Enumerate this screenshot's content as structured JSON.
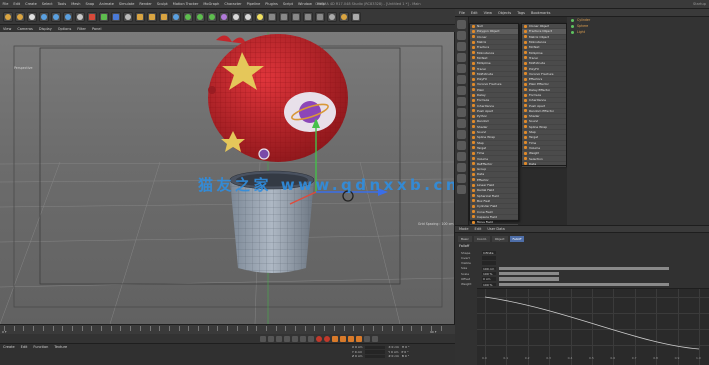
{
  "window": {
    "title": "CINEMA 4D R17.048 Studio (RC83328) - [Untitled 1 *] - Main",
    "right_text": "Startup"
  },
  "menubar": [
    "File",
    "Edit",
    "Create",
    "Select",
    "Tools",
    "Mesh",
    "Snap",
    "Animate",
    "Simulate",
    "Render",
    "Sculpt",
    "Motion Tracker",
    "MoGraph",
    "Character",
    "Pipeline",
    "Plugins",
    "Script",
    "Window",
    "Help"
  ],
  "viewport": {
    "menu": [
      "View",
      "Cameras",
      "Display",
      "Options",
      "Filter",
      "Panel"
    ],
    "label": "Perspective",
    "resolution": "Grid Spacing : 100 cm"
  },
  "watermark": "猫友之家 www.qdnxxb.cn",
  "popup_left": [
    "Null",
    "Polygon Object",
    "Cloner",
    "Matrix",
    "Fracture",
    "MoInstance",
    "MoText",
    "MoSpline",
    "Tracer",
    "MoExtrude",
    "PolyFX",
    "Voronoi Fracture",
    "Plain",
    "Delay",
    "Formula",
    "Inheritance",
    "Push Apart",
    "Python",
    "Random",
    "Shader",
    "Sound",
    "Spline Wrap",
    "Step",
    "Target",
    "Time",
    "Volume",
    "ReEffector",
    "Group",
    "Data",
    "Effector",
    "Linear Field",
    "Radial Field",
    "Spherical Field",
    "Box Field",
    "Cylinder Field",
    "Cone Field",
    "Capsule Field",
    "Torus Field"
  ],
  "popup_right": [
    "Cloner Object",
    "Fracture Object",
    "Matrix Object",
    "MoInstance",
    "MoText",
    "MoSpline",
    "Tracer",
    "MoExtrude",
    "PolyFX",
    "Voronoi Fracture",
    "Effectors",
    "Plain Effector",
    "Delay Effector",
    "Formula",
    "Inheritance",
    "Push Apart",
    "Random Effector",
    "Shader",
    "Sound",
    "Spline Wrap",
    "Step",
    "Target",
    "Time",
    "Volume",
    "Weight",
    "Selection",
    "Data"
  ],
  "object_manager": {
    "menu": [
      "File",
      "Edit",
      "View",
      "Objects",
      "Tags",
      "Bookmarks"
    ],
    "objects": [
      "Cylinder",
      "Sphere",
      "Light"
    ]
  },
  "attributes": {
    "menu": [
      "Mode",
      "Edit",
      "User Data"
    ],
    "tabs": [
      "Basic",
      "Coord.",
      "Object",
      "Falloff"
    ],
    "active_tab": "Falloff",
    "section": "Falloff",
    "rows": [
      {
        "label": "Shape",
        "value": "Infinite"
      },
      {
        "label": "Invert",
        "value": ""
      },
      {
        "label": "Visible",
        "value": ""
      },
      {
        "label": "Size",
        "value": "100 cm"
      },
      {
        "label": "Scale",
        "value": "100 %"
      },
      {
        "label": "Offset",
        "value": "0 cm"
      },
      {
        "label": "Weight",
        "value": "100 %"
      }
    ],
    "graph_x": [
      "0.0",
      "0.1",
      "0.2",
      "0.3",
      "0.4",
      "0.5",
      "0.6",
      "0.7",
      "0.8",
      "0.9",
      "1.0"
    ]
  },
  "bottom": {
    "tabs": [
      "Create",
      "Edit",
      "Function",
      "Texture"
    ],
    "coords": [
      {
        "label": "X 0 cm",
        "size": "X 0 cm",
        "rot": "H 0 °"
      },
      {
        "label": "Y 0 cm",
        "size": "Y 0 cm",
        "rot": "P 0 °"
      },
      {
        "label": "Z 0 cm",
        "size": "Z 0 cm",
        "rot": "B 0 °"
      }
    ]
  },
  "timeline": {
    "start": "0 F",
    "end": "90 F"
  },
  "colors": {
    "accent": "#e08a2a",
    "selection": "#4e6ea8",
    "watermark": "#2f8ee0",
    "pig_body": "#c4262b",
    "cup_body": "#8e9aa8"
  }
}
